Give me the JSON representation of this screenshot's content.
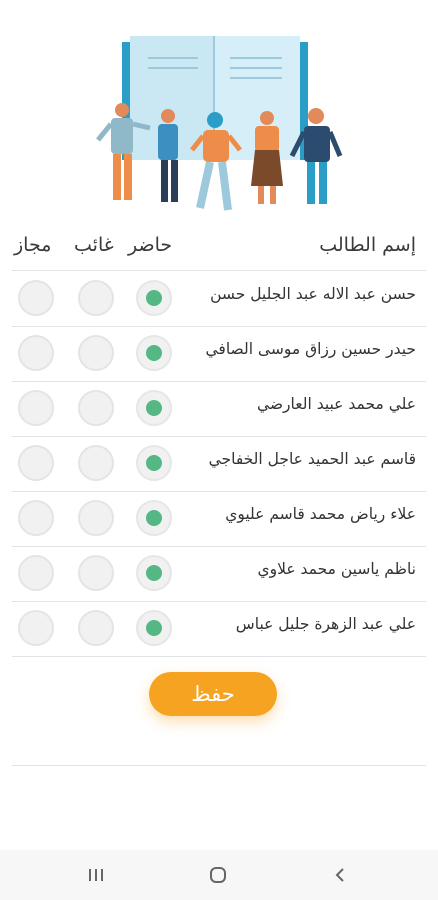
{
  "header": {
    "student_name": "إسم الطالب",
    "present": "حاضر",
    "absent": "غائب",
    "excused": "مجاز"
  },
  "students": [
    {
      "name": "حسن عبد الاله عبد الجليل حسن",
      "status": "present"
    },
    {
      "name": "حيدر حسين رزاق موسى الصافي",
      "status": "present"
    },
    {
      "name": "علي محمد عبيد العارضي",
      "status": "present"
    },
    {
      "name": "قاسم عبد الحميد عاجل الخفاجي",
      "status": "present"
    },
    {
      "name": "علاء رياض محمد قاسم عليوي",
      "status": "present"
    },
    {
      "name": "ناظم ياسين محمد علاوي",
      "status": "present"
    },
    {
      "name": "علي عبد الزهرة جليل عباس",
      "status": "present"
    }
  ],
  "save_label": "حفظ",
  "colors": {
    "accent": "#f6a321",
    "selected": "#55b784"
  },
  "navbar": {
    "icons": [
      "recents-icon",
      "home-icon",
      "back-icon"
    ]
  }
}
